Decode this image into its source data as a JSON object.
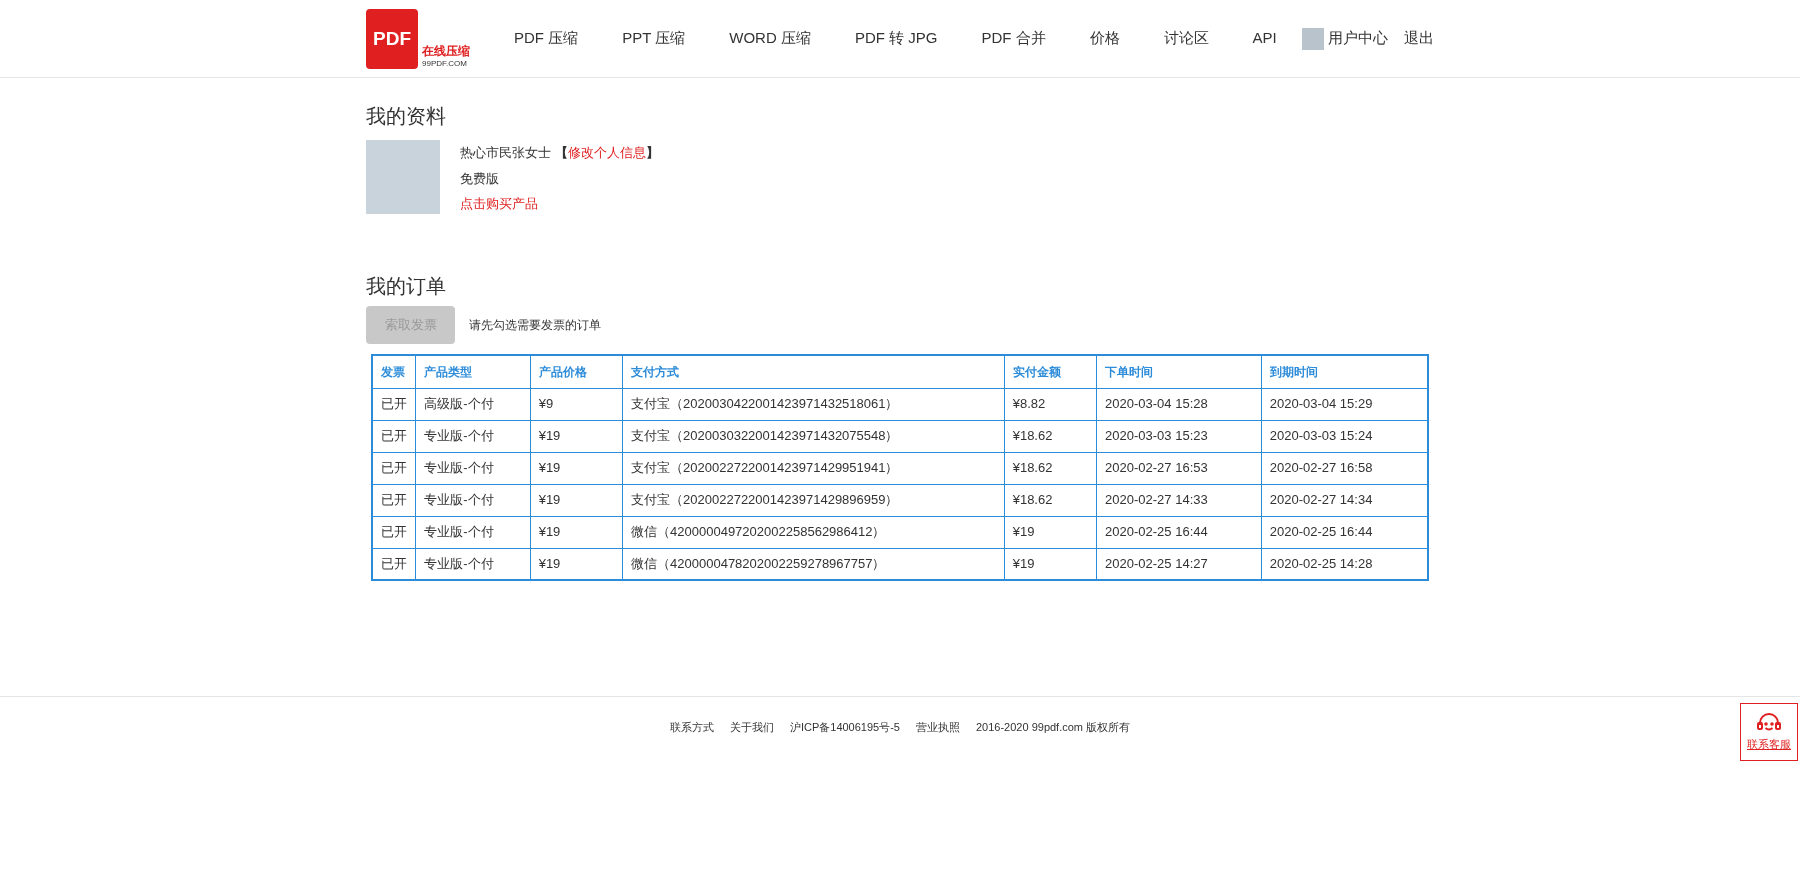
{
  "logo": {
    "mark": "PDF",
    "tagline": "在线压缩",
    "domain": "99PDF.COM"
  },
  "nav": [
    "PDF 压缩",
    "PPT 压缩",
    "WORD 压缩",
    "PDF 转 JPG",
    "PDF 合并",
    "价格",
    "讨论区",
    "API"
  ],
  "user_menu": {
    "user_center": "用户中心",
    "logout": "退出"
  },
  "profile": {
    "title": "我的资料",
    "name": "热心市民张女士",
    "edit_open": "【",
    "edit_link": "修改个人信息",
    "edit_close": "】",
    "plan": "免费版",
    "buy_link": "点击购买产品"
  },
  "orders": {
    "title": "我的订单",
    "invoice_button": {
      "label": "索取发票",
      "disabled": true
    },
    "hint": "请先勾选需要发票的订单",
    "table": {
      "columns": [
        "发票",
        "产品类型",
        "产品价格",
        "支付方式",
        "实付金额",
        "下单时间",
        "到期时间"
      ],
      "rows": [
        [
          "已开",
          "高级版-个付",
          "¥9",
          "支付宝（2020030422001423971432518061）",
          "¥8.82",
          "2020-03-04 15:28",
          "2020-03-04 15:29"
        ],
        [
          "已开",
          "专业版-个付",
          "¥19",
          "支付宝（2020030322001423971432075548）",
          "¥18.62",
          "2020-03-03 15:23",
          "2020-03-03 15:24"
        ],
        [
          "已开",
          "专业版-个付",
          "¥19",
          "支付宝（2020022722001423971429951941）",
          "¥18.62",
          "2020-02-27 16:53",
          "2020-02-27 16:58"
        ],
        [
          "已开",
          "专业版-个付",
          "¥19",
          "支付宝（2020022722001423971429896959）",
          "¥18.62",
          "2020-02-27 14:33",
          "2020-02-27 14:34"
        ],
        [
          "已开",
          "专业版-个付",
          "¥19",
          "微信（4200000497202002258562986412）",
          "¥19",
          "2020-02-25 16:44",
          "2020-02-25 16:44"
        ],
        [
          "已开",
          "专业版-个付",
          "¥19",
          "微信（4200000478202002259278967757）",
          "¥19",
          "2020-02-25 14:27",
          "2020-02-25 14:28"
        ]
      ]
    }
  },
  "footer": [
    "联系方式",
    "关于我们",
    "沪ICP备14006195号-5",
    "营业执照",
    "2016-2020 99pdf.com 版权所有"
  ],
  "support": {
    "label": "联系客服"
  }
}
